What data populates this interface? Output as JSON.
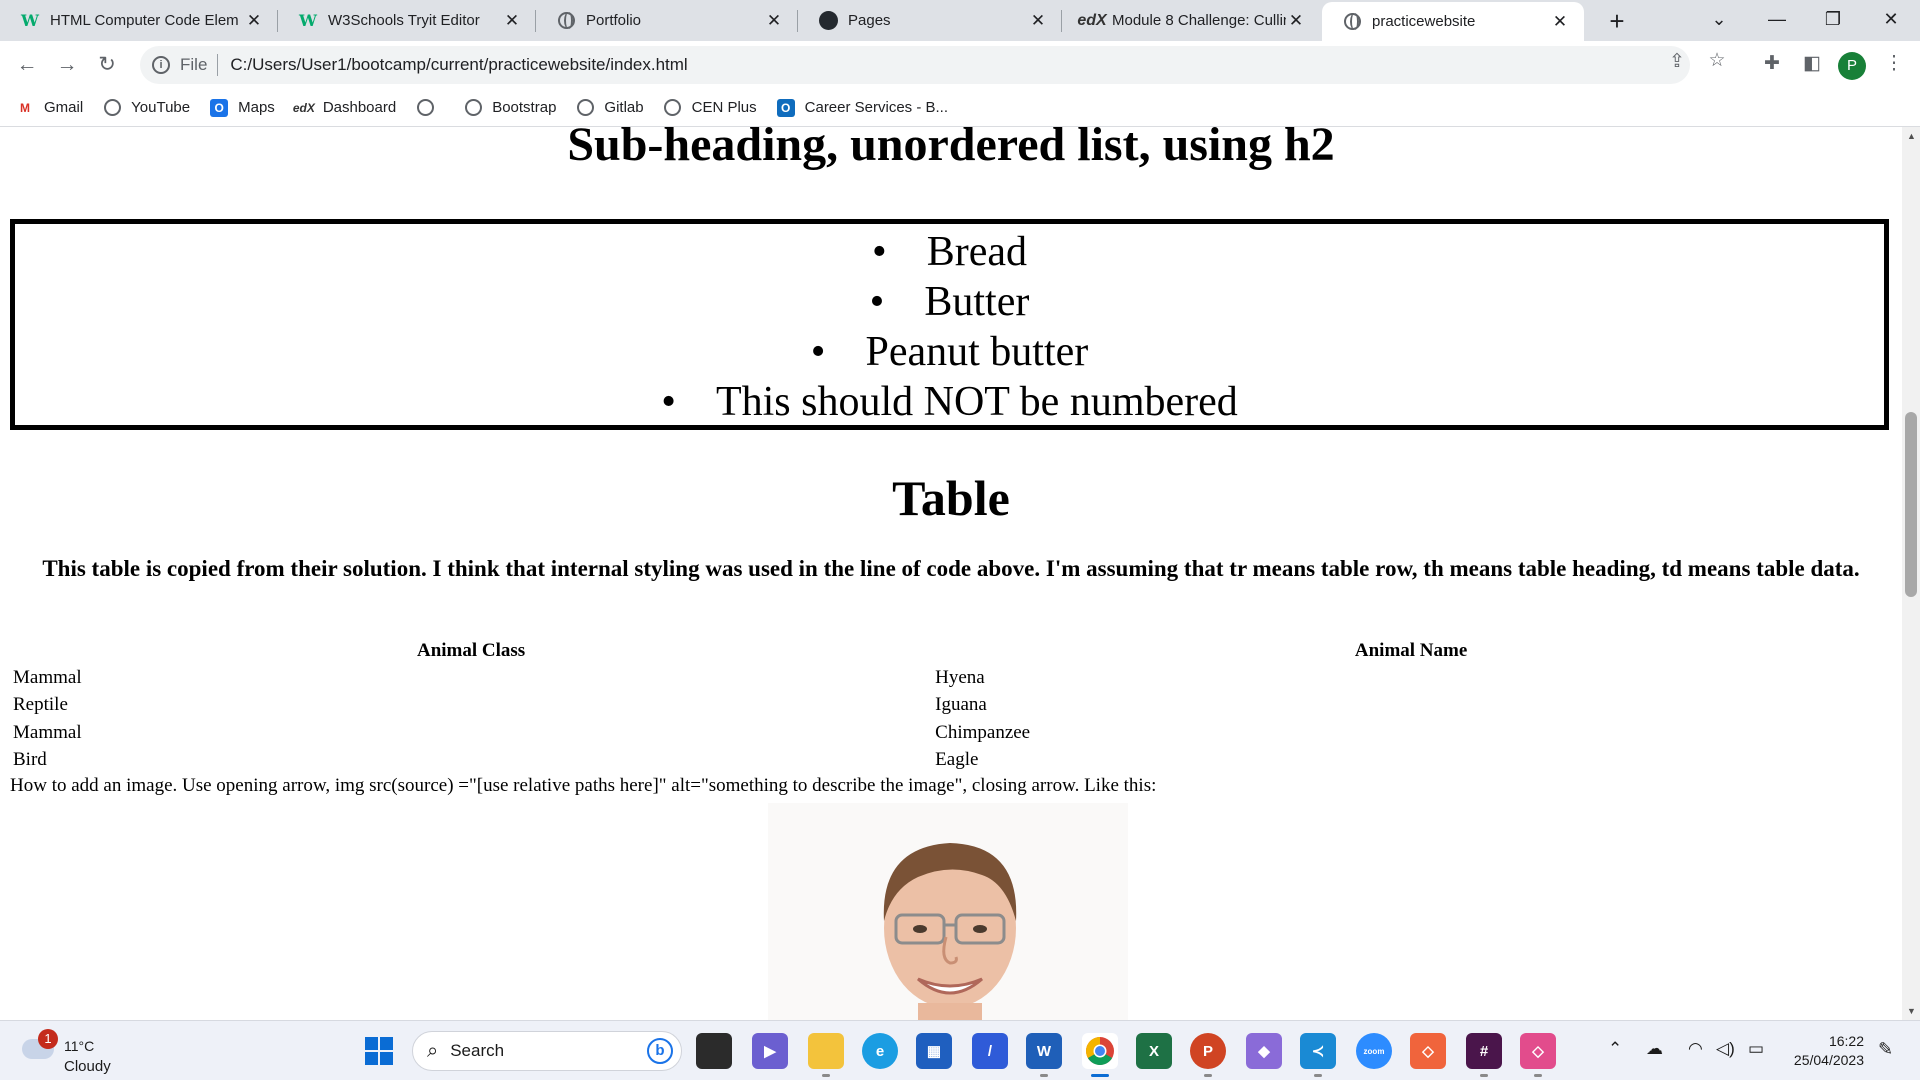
{
  "browser": {
    "tabs": [
      {
        "title": "HTML Computer Code Elem",
        "icon": "w3schools-icon",
        "active": false
      },
      {
        "title": "W3Schools Tryit Editor",
        "icon": "w3schools-icon",
        "active": false
      },
      {
        "title": "Portfolio",
        "icon": "globe-icon",
        "active": false
      },
      {
        "title": "Pages",
        "icon": "github-icon",
        "active": false
      },
      {
        "title": "Module 8 Challenge: Cullin",
        "icon": "edx-icon",
        "active": false
      },
      {
        "title": "practicewebsite",
        "icon": "globe-icon",
        "active": true
      }
    ],
    "address": {
      "scheme_label": "File",
      "url": "C:/Users/User1/bootcamp/current/practicewebsite/index.html"
    },
    "profile_initial": "P",
    "bookmarks": [
      {
        "label": "Gmail",
        "icon": "gmail-icon"
      },
      {
        "label": "YouTube",
        "icon": "globe-icon"
      },
      {
        "label": "Maps",
        "icon": "outlook-icon"
      },
      {
        "label": "Dashboard",
        "icon": "edx-icon"
      },
      {
        "label": "",
        "icon": "globe-icon"
      },
      {
        "label": "Bootstrap",
        "icon": "globe-icon"
      },
      {
        "label": "Gitlab",
        "icon": "globe-icon"
      },
      {
        "label": "CEN Plus",
        "icon": "globe-icon"
      },
      {
        "label": "Career Services - B...",
        "icon": "outlook-icon"
      }
    ]
  },
  "page": {
    "subheading": "Sub-heading, unordered list, using h2",
    "list_items": [
      "Bread",
      "Butter",
      "Peanut butter",
      "This should NOT be numbered"
    ],
    "table_heading": "Table",
    "table_description": "This table is copied from their solution. I think that internal styling was used in the line of code above. I'm assuming that tr means table row, th means table heading, td means table data.",
    "table": {
      "headers": [
        "Animal Class",
        "Animal Name"
      ],
      "rows": [
        [
          "Mammal",
          "Hyena"
        ],
        [
          "Reptile",
          "Iguana"
        ],
        [
          "Mammal",
          "Chimpanzee"
        ],
        [
          "Bird",
          "Eagle"
        ]
      ]
    },
    "image_caption": "How to add an image. Use opening arrow, img src(source) =\"[use relative paths here]\" alt=\"something to describe the image\", closing arrow. Like this:"
  },
  "taskbar": {
    "weather": {
      "temp": "11°C",
      "desc": "Cloudy",
      "badge": "1"
    },
    "search_label": "Search",
    "time": "16:22",
    "date": "25/04/2023"
  },
  "colors": {
    "accent": "#0a6cd4",
    "w3schools": "#04aa6d",
    "profile": "#188038"
  }
}
